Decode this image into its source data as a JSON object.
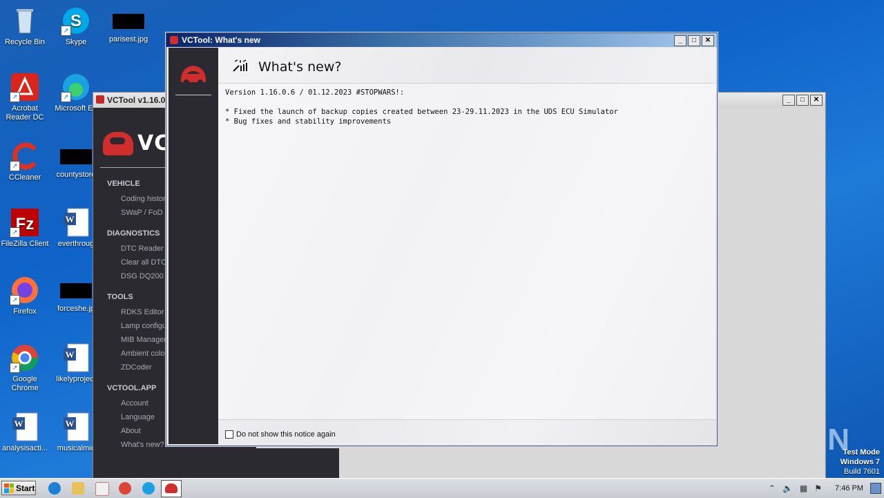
{
  "desktop": {
    "icons": [
      {
        "label": "Recycle Bin"
      },
      {
        "label": "Skype"
      },
      {
        "label": "parisest.jpg"
      },
      {
        "label": "Acrobat Reader DC"
      },
      {
        "label": "Microsoft Ed"
      },
      {
        "label": "CCleaner"
      },
      {
        "label": "countystore"
      },
      {
        "label": "FileZilla Client"
      },
      {
        "label": "everthroug"
      },
      {
        "label": "Firefox"
      },
      {
        "label": "forceshe.jp"
      },
      {
        "label": "Google Chrome"
      },
      {
        "label": "likelyproject"
      },
      {
        "label": "analysisacti..."
      },
      {
        "label": "musicalmic"
      }
    ]
  },
  "back_window": {
    "title": "VCTool v1.16.0.",
    "logo_text": "VC",
    "sections": [
      {
        "title": "VEHICLE",
        "items": [
          "Coding history",
          "SWaP / FoD"
        ]
      },
      {
        "title": "DIAGNOSTICS",
        "items": [
          "DTC Reader",
          "Clear all DTC",
          "DSG DQ200 D"
        ]
      },
      {
        "title": "TOOLS",
        "items": [
          "RDKS Editor",
          "Lamp configu",
          "MIB Manager",
          "Ambient colo",
          "ZDCoder"
        ]
      },
      {
        "title": "VCTOOL.APP",
        "items": [
          "Account",
          "Language",
          "About",
          "What's new?"
        ]
      }
    ]
  },
  "dialog": {
    "title": "VCTool: What's new",
    "heading": "What's new?",
    "body_lines": [
      "Version 1.16.0.6 / 01.12.2023 #STOPWARS!:",
      "",
      "* Fixed the launch of backup copies created between 23-29.11.2023 in the UDS ECU Simulator",
      "* Bug fixes and stability improvements"
    ],
    "checkbox_label": "Do not show this notice again"
  },
  "taskbar": {
    "start_label": "Start",
    "clock": "7:46 PM"
  },
  "watermark": "ANY RUN",
  "test_mode": {
    "line1": "Test Mode",
    "line2": "Windows 7",
    "line3": "Build 7601"
  },
  "colors": {
    "accent_red": "#d12d2d",
    "sidebar_bg": "#2a2a30",
    "titlebar_blue": "#0a246a"
  }
}
